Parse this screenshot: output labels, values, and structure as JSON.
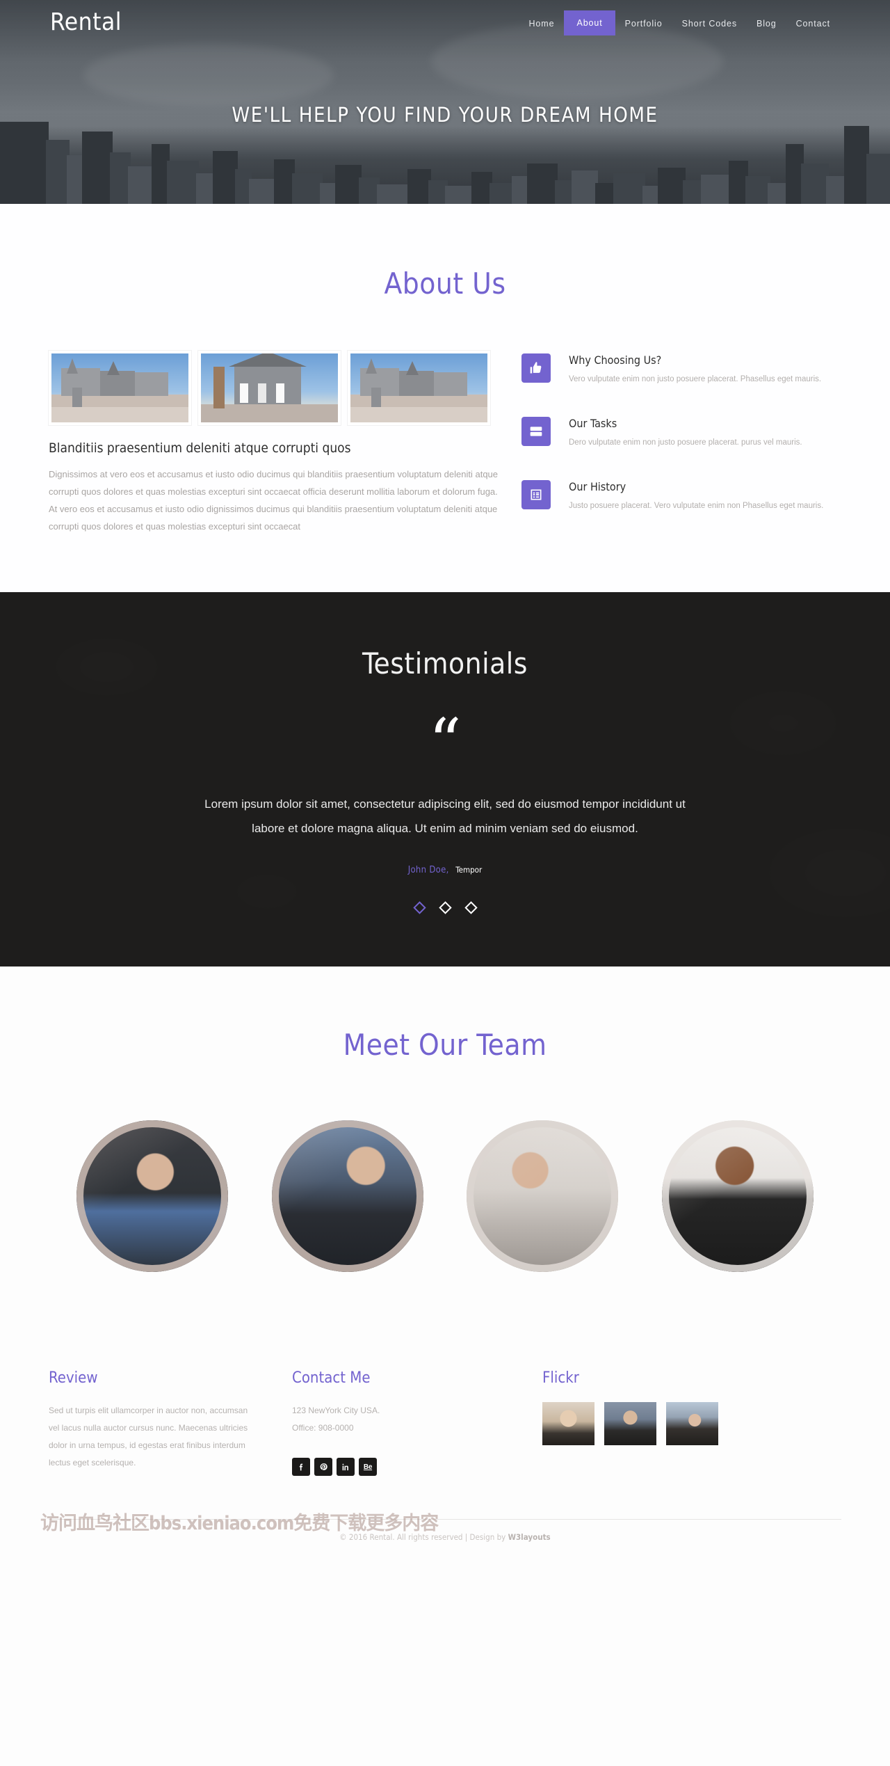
{
  "header": {
    "logo": "Rental",
    "nav": [
      {
        "label": "Home",
        "active": false
      },
      {
        "label": "About",
        "active": true
      },
      {
        "label": "Portfolio",
        "active": false
      },
      {
        "label": "Short Codes",
        "active": false
      },
      {
        "label": "Blog",
        "active": false
      },
      {
        "label": "Contact",
        "active": false
      }
    ],
    "hero_title": "WE'LL HELP YOU FIND YOUR DREAM HOME"
  },
  "about": {
    "title": "About Us",
    "heading": "Blanditiis praesentium deleniti atque corrupti quos",
    "paragraph": "Dignissimos at vero eos et accusamus et iusto odio ducimus qui blanditiis praesentium voluptatum deleniti atque corrupti quos dolores et quas molestias excepturi sint occaecat officia deserunt mollitia laborum et dolorum fuga. At vero eos et accusamus et iusto odio dignissimos ducimus qui blanditiis praesentium voluptatum deleniti atque corrupti quos dolores et quas molestias excepturi sint occaecat",
    "thumbs": [
      {
        "alt": "victorian-houses-street"
      },
      {
        "alt": "two-story-house-porch"
      },
      {
        "alt": "victorian-houses-street"
      }
    ],
    "features": [
      {
        "icon": "thumbs-up-icon",
        "title": "Why Choosing Us?",
        "text": "Vero vulputate enim non justo posuere placerat. Phasellus eget mauris."
      },
      {
        "icon": "server-list-icon",
        "title": "Our Tasks",
        "text": "Dero vulputate enim non justo posuere placerat. purus vel mauris."
      },
      {
        "icon": "list-alt-icon",
        "title": "Our History",
        "text": "Justo posuere placerat. Vero vulputate enim non Phasellus eget mauris."
      }
    ]
  },
  "testimonials": {
    "title": "Testimonials",
    "quote_glyph": "“",
    "text": "Lorem ipsum dolor sit amet, consectetur adipiscing elit, sed do eiusmod tempor incididunt ut labore et dolore magna aliqua. Ut enim ad minim veniam sed do eiusmod.",
    "author_name": "John Doe,",
    "author_role": "Tempor",
    "dots": [
      {
        "active": true
      },
      {
        "active": false
      },
      {
        "active": false
      }
    ]
  },
  "team": {
    "title": "Meet Our Team",
    "members": [
      {
        "alt": "man-with-glasses-working"
      },
      {
        "alt": "woman-dark-hair-office"
      },
      {
        "alt": "woman-ponytail-profile"
      },
      {
        "alt": "man-in-suit-and-tie"
      }
    ]
  },
  "footer": {
    "review": {
      "title": "Review",
      "text": "Sed ut turpis elit ullamcorper in auctor non, accumsan vel lacus nulla auctor cursus nunc. Maecenas ultricies dolor in urna tempus, id egestas erat finibus interdum lectus eget scelerisque."
    },
    "contact": {
      "title": "Contact Me",
      "address": "123 NewYork City USA.",
      "office": "Office: 908-0000",
      "socials": [
        {
          "name": "facebook",
          "label": "f"
        },
        {
          "name": "pinterest",
          "label": "P"
        },
        {
          "name": "linkedin",
          "label": "in"
        },
        {
          "name": "behance",
          "label": "Be"
        }
      ]
    },
    "flickr": {
      "title": "Flickr",
      "photos": [
        {
          "alt": "blonde-woman-portrait"
        },
        {
          "alt": "man-with-dark-jacket"
        },
        {
          "alt": "woman-with-beanie-hat"
        }
      ]
    },
    "copyright_prefix": "© 2016 Rental. All rights reserved | Design by ",
    "copyright_brand": "W3layouts",
    "watermark": "访问血鸟社区bbs.xieniao.com免费下载更多内容"
  },
  "colors": {
    "accent": "#7363cf",
    "dark": "#1e1d1c",
    "muted": "#b3afad"
  }
}
